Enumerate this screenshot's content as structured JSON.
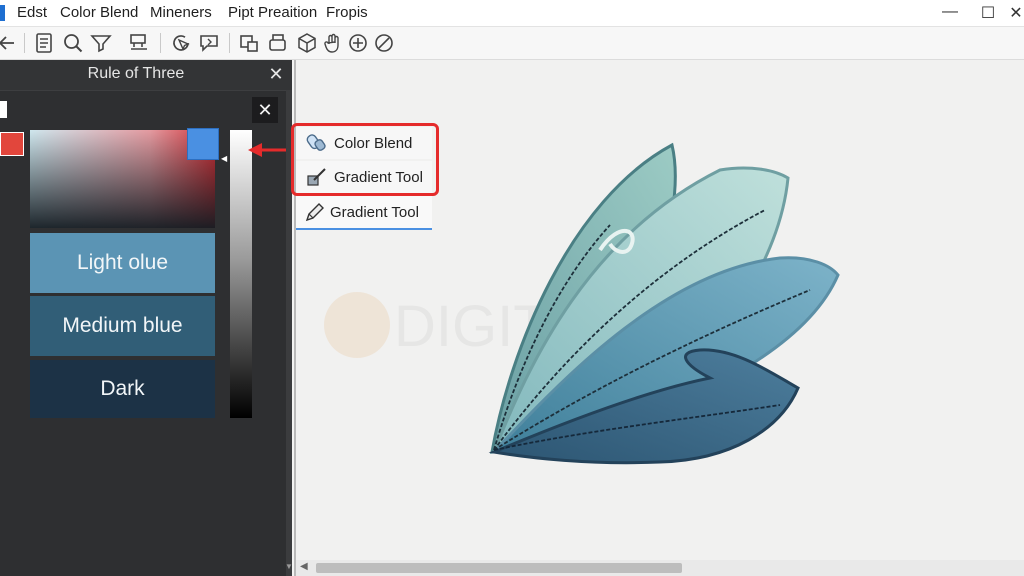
{
  "menubar": {
    "items": [
      "Edst",
      "Color Blend",
      "Mineners",
      "Pipt Preaition",
      "Fropis"
    ],
    "window_controls": {
      "minimize": "—",
      "maximize": "☐",
      "close": "✕"
    }
  },
  "toolbar": {
    "icons": [
      "back-arrow-icon",
      "document-icon",
      "search-icon",
      "funnel-icon",
      "stamp-icon",
      "cursor-refresh-icon",
      "comment-icon",
      "layers-icon",
      "copy-icon",
      "cube-icon",
      "hand-icon",
      "add-circle-icon",
      "no-entry-icon"
    ]
  },
  "panel": {
    "title": "Rule of Three",
    "close_glyph": "✕",
    "inner_close_glyph": "✕",
    "swatches": [
      {
        "label": "Light olue",
        "color": "#5b94b4"
      },
      {
        "label": "Medium blue",
        "color": "#315e77"
      },
      {
        "label": "Dark",
        "color": "#1c3246"
      }
    ],
    "selected_color": "#4a90e2",
    "foreground_chip": "#e2463c"
  },
  "tool_menu": {
    "items": [
      {
        "label": "Color Blend",
        "icon": "blend-icon"
      },
      {
        "label": "Gradient Tool",
        "icon": "gradient-icon"
      },
      {
        "label": "Gradient Tool",
        "icon": "pencil-icon"
      }
    ],
    "highlight_color": "#e52b2b"
  },
  "canvas": {
    "watermark": "DIGIT",
    "leaf_colors": [
      "#8fc2bb",
      "#a9d3cf",
      "#6ea6bd",
      "#3f6f8e"
    ]
  }
}
